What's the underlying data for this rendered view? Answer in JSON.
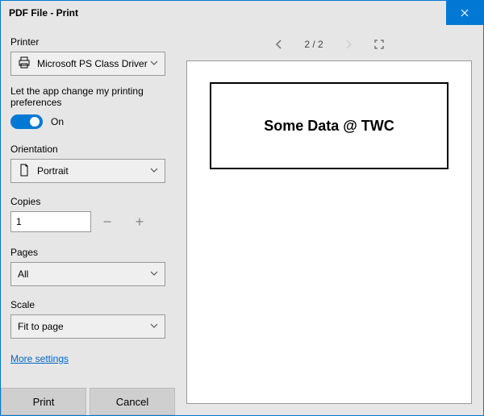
{
  "window": {
    "title": "PDF File - Print"
  },
  "panel": {
    "printer_label": "Printer",
    "printer_value": "Microsoft PS Class Driver",
    "pref_text": "Let the app change my printing preferences",
    "toggle_state": "On",
    "orientation_label": "Orientation",
    "orientation_value": "Portrait",
    "copies_label": "Copies",
    "copies_value": "1",
    "pages_label": "Pages",
    "pages_value": "All",
    "scale_label": "Scale",
    "scale_value": "Fit to page",
    "more_link": "More settings",
    "print_btn": "Print",
    "cancel_btn": "Cancel"
  },
  "preview": {
    "page_indicator": "2 / 2",
    "doc_text": "Some Data @ TWC"
  }
}
